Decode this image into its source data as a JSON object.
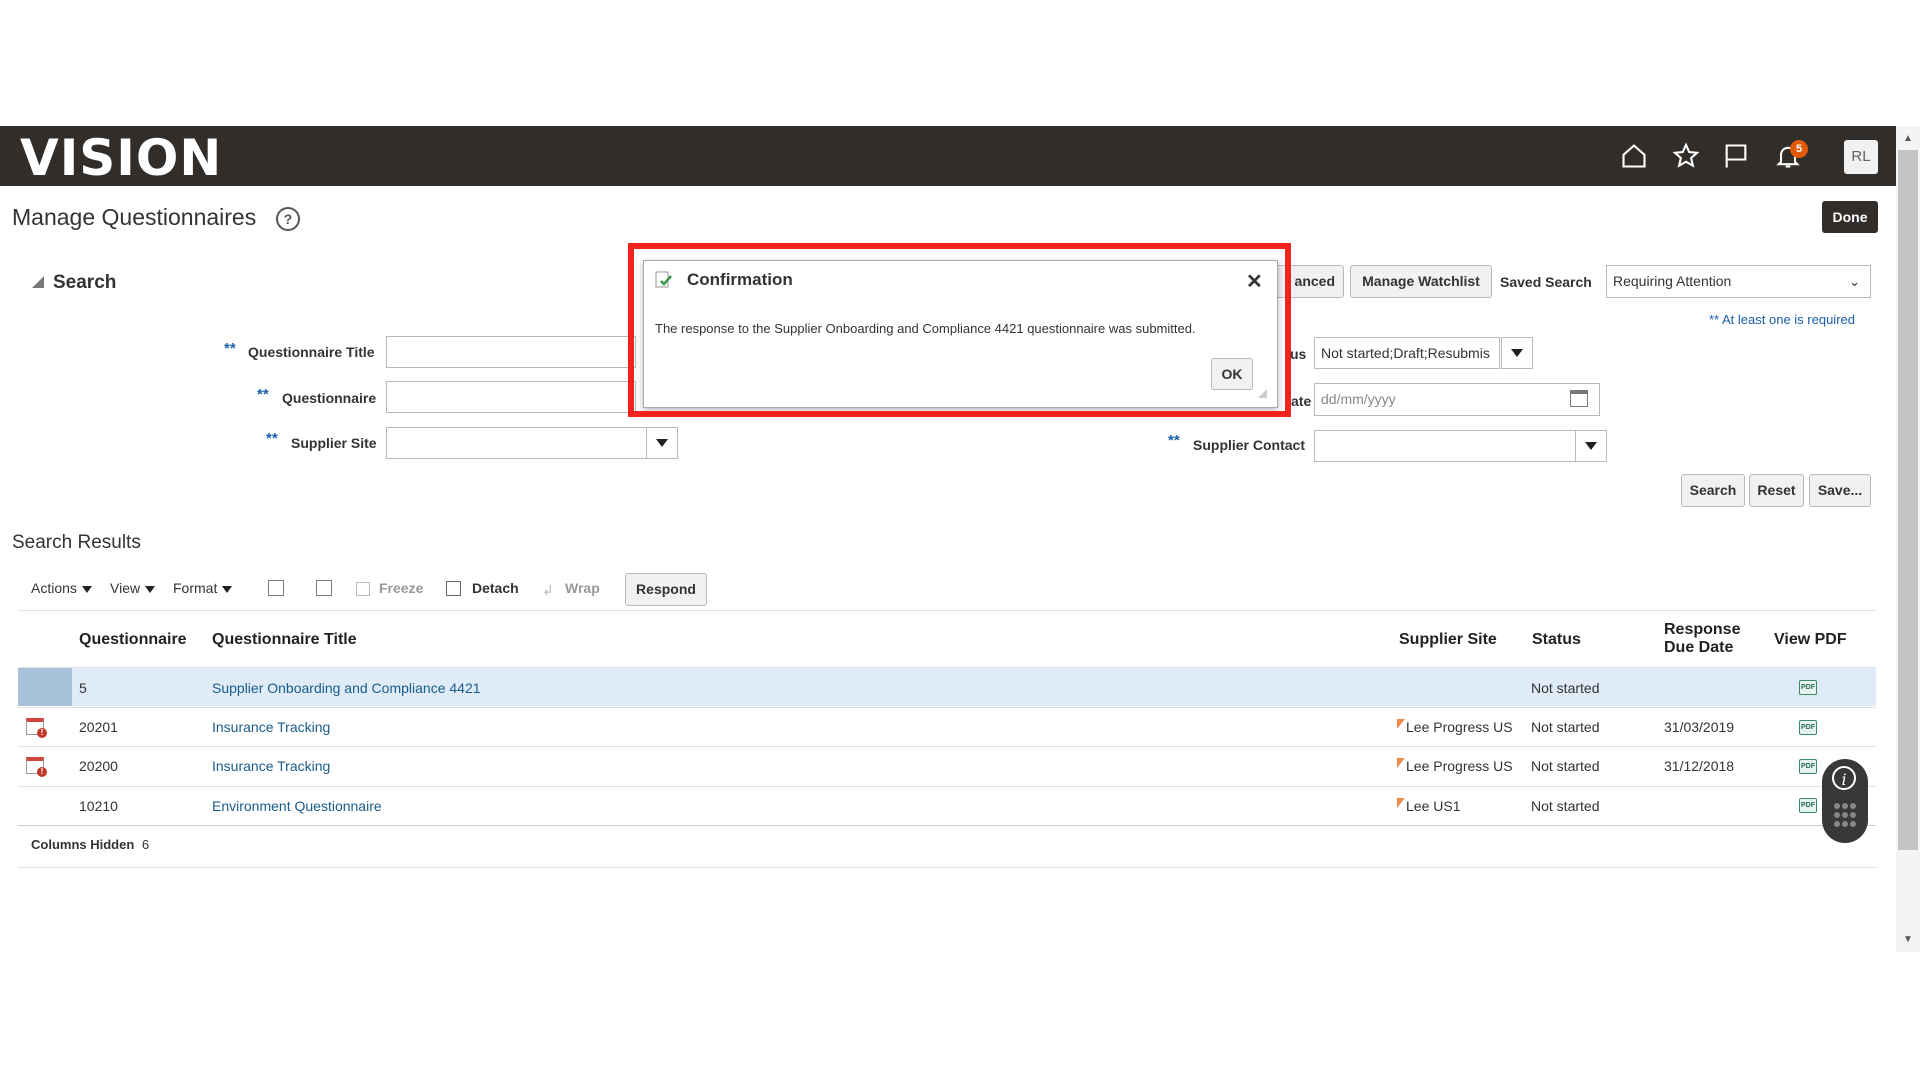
{
  "app": {
    "logo": "VISION",
    "notification_count": "5",
    "user_initials": "RL"
  },
  "page": {
    "title": "Manage Questionnaires",
    "help": "?",
    "done": "Done"
  },
  "search": {
    "heading": "Search",
    "advanced": "anced",
    "manage_watchlist": "Manage Watchlist",
    "saved_search_label": "Saved Search",
    "saved_search_value": "Requiring Attention",
    "required_note": "** At least one is required",
    "req_mark": "**",
    "questionnaire_title_label": "Questionnaire Title",
    "questionnaire_label": "Questionnaire",
    "supplier_site_label": "Supplier Site",
    "status_label": "us",
    "status_value": "Not started;Draft;Resubmis",
    "date_label": "ate",
    "date_placeholder": "dd/mm/yyyy",
    "supplier_contact_label": "Supplier Contact",
    "search_btn": "Search",
    "reset_btn": "Reset",
    "save_btn": "Save..."
  },
  "results": {
    "heading": "Search Results",
    "toolbar": {
      "actions": "Actions",
      "view": "View",
      "format": "Format",
      "freeze": "Freeze",
      "detach": "Detach",
      "wrap": "Wrap",
      "respond": "Respond"
    },
    "columns": {
      "questionnaire": "Questionnaire",
      "title": "Questionnaire Title",
      "site": "Supplier Site",
      "status": "Status",
      "due_1": "Response",
      "due_2": "Due Date",
      "pdf": "View PDF"
    },
    "rows": [
      {
        "id": "5",
        "title": "Supplier Onboarding and Compliance 4421",
        "site": "",
        "status": "Not started",
        "due": ""
      },
      {
        "id": "20201",
        "title": "Insurance Tracking",
        "site": "Lee Progress US",
        "status": "Not started",
        "due": "31/03/2019"
      },
      {
        "id": "20200",
        "title": "Insurance Tracking",
        "site": "Lee Progress US",
        "status": "Not started",
        "due": "31/12/2018"
      },
      {
        "id": "10210",
        "title": "Environment Questionnaire",
        "site": "Lee US1",
        "status": "Not started",
        "due": ""
      }
    ],
    "pdf_icon_text": "PDF",
    "columns_hidden_label": "Columns Hidden",
    "columns_hidden_count": "6"
  },
  "dialog": {
    "title": "Confirmation",
    "close": "✕",
    "message": "The response to the Supplier Onboarding and Compliance 4421 questionnaire was submitted.",
    "ok": "OK"
  },
  "widget": {
    "info": "i"
  },
  "colors": {
    "header_bg": "#312d2a",
    "highlight": "#f0231d",
    "selected_row": "#dfecf8",
    "link": "#1a5c8a"
  }
}
